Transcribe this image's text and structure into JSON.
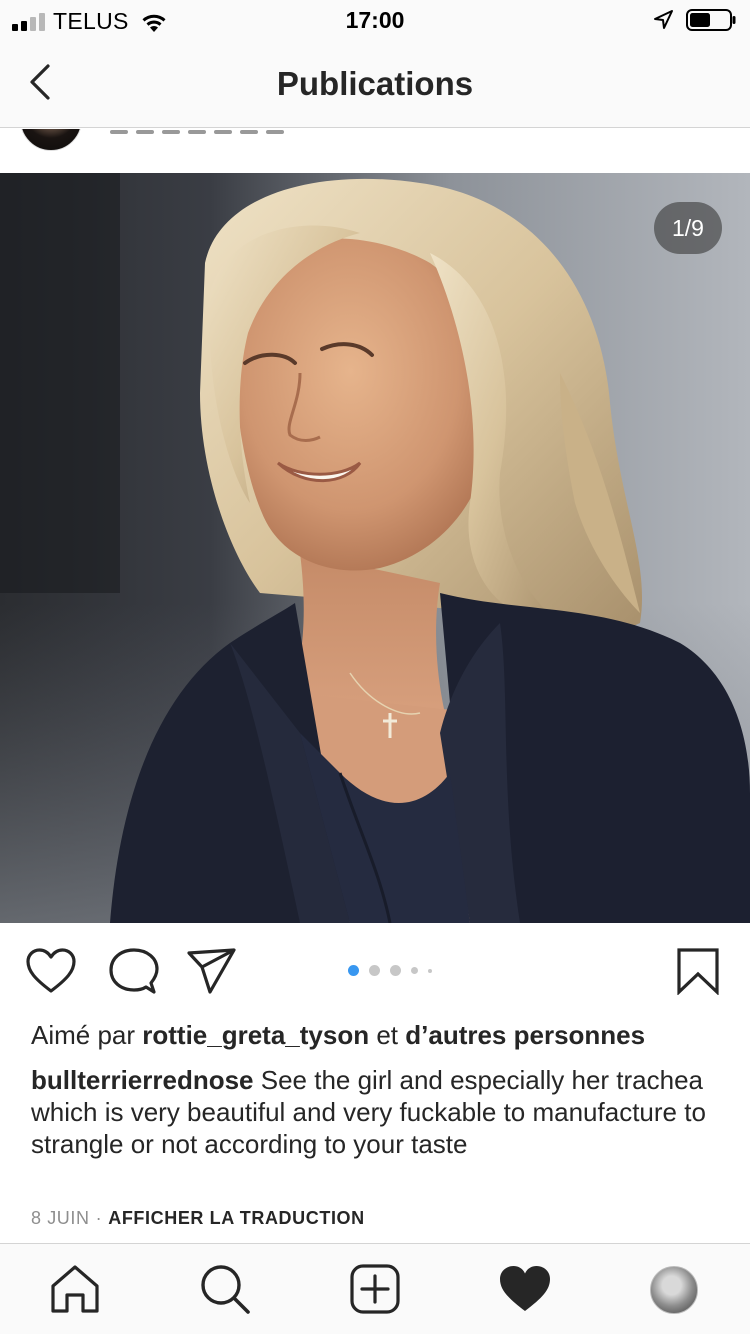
{
  "status_bar": {
    "carrier": "TELUS",
    "time": "17:00",
    "signal_bars_filled": 2,
    "signal_bars_total": 4,
    "battery_level": 0.5
  },
  "nav": {
    "title": "Publications",
    "back_icon": "chevron-left-icon"
  },
  "post": {
    "image_counter": "1/9",
    "carousel": {
      "total_dots": 5,
      "active_index": 0
    },
    "likes": {
      "prefix": "Aimé par ",
      "user": "rottie_greta_tyson",
      "connector": " et ",
      "others": "d’autres personnes"
    },
    "caption": {
      "username": "bullterrierrednose",
      "text": " See the girl and especially her trachea which is very beautiful and very fuckable to manufacture to strangle or not according to your taste"
    },
    "date": "8 JUIN",
    "separator": "·",
    "translate_label": "AFFICHER LA TRADUCTION"
  },
  "icons": {
    "like": "heart-outline-icon",
    "comment": "comment-bubble-icon",
    "share": "paper-plane-icon",
    "save": "bookmark-icon"
  },
  "tab_bar": {
    "items": [
      "home-icon",
      "search-icon",
      "add-post-icon",
      "activity-heart-icon",
      "profile-avatar"
    ],
    "active": "activity-heart-icon"
  },
  "colors": {
    "accent_blue": "#3897f0",
    "text": "#262626",
    "muted": "#8e8e8e",
    "bar_bg": "#fafafa"
  }
}
